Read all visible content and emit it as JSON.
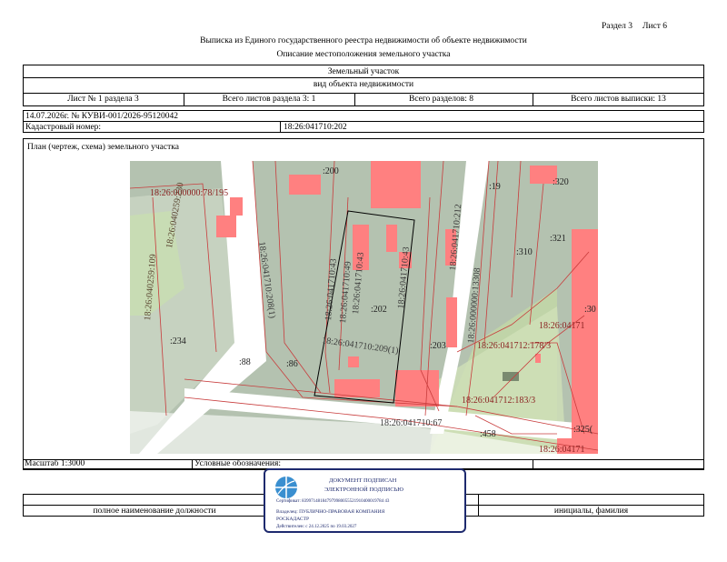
{
  "header": {
    "section": "Раздел 3",
    "sheet": "Лист 6",
    "title": "Выписка из Единого государственного реестра недвижимости об объекте недвижимости",
    "subtitle": "Описание местоположения земельного участка"
  },
  "object": {
    "type": "Земельный участок",
    "type_caption": "вид объекта недвижимости"
  },
  "sheet_info": {
    "sheet_no": "Лист № 1 раздела 3",
    "total_sheets_section": "Всего листов раздела 3: 1",
    "total_sections": "Всего разделов: 8",
    "total_sheets": "Всего листов выписки: 13"
  },
  "record": {
    "date_number": "14.07.2026г. № КУВИ-001/2026-95120042",
    "cadastral_label": "Кадастровый номер:",
    "cadastral_value": "18:26:041710:202"
  },
  "plan": {
    "title": "План (чертеж, схема) земельного участка"
  },
  "map_labels": {
    "l200": ":200",
    "l19": ":19",
    "l320": ":320",
    "l78195": "18:26:000000:78/195",
    "l040259_230": "18:26:040259:230",
    "l040259_109": "18:26:040259:109",
    "l041710_43a": "18:26:041710:43",
    "l041710_49": "18:26:041710:49",
    "l041710_43b": "18:26:041710:43",
    "l041710_43c": "18:26:041710:43",
    "l041710_212": "18:26:041710:212",
    "l000000_13308": "18:26:000000:13308",
    "l310": ":310",
    "l321": ":321",
    "l208": "18:26:041710:208(1)",
    "l202": ":202",
    "l203": ":203",
    "l234": ":234",
    "l88": ":88",
    "l86": ":86",
    "l209": "18:26:041710:209(1)",
    "l178": "18:26:041712:178/3",
    "l041712": "18:26:04171",
    "l30": ":30",
    "l183": "18:26:041712:183/3",
    "l67": "18:26:041710:67",
    "l458": ":458",
    "l325": ":325(",
    "lbottom": "18:26:04171"
  },
  "footer": {
    "scale": "Масштаб 1:3000",
    "legend": "Условные обозначения:",
    "position_caption": "полное наименование должности",
    "initials_caption": "инициалы, фамилия"
  },
  "stamp": {
    "line1": "ДОКУМЕНТ ПОДПИСАН",
    "line2": "ЭЛЕКТРОННОЙ ПОДПИСЬЮ",
    "certificate": "Сертификат: 839971481847979980055521910400019784 43",
    "owner": "Владелец: ПУБЛИЧНО-ПРАВОВАЯ КОМПАНИЯ",
    "owner2": "РОСКАДАСТР",
    "valid": "Действителен: с 24.12.2025 по 19.03.2027"
  },
  "colors": {
    "parcel_gray": "#b4c2b0",
    "building_red": "#ff8080",
    "road_white": "#ffffff",
    "boundary_red": "#c83c3c",
    "label_dark_red": "#8a1f1f",
    "stamp_blue": "#1e2a6e"
  }
}
